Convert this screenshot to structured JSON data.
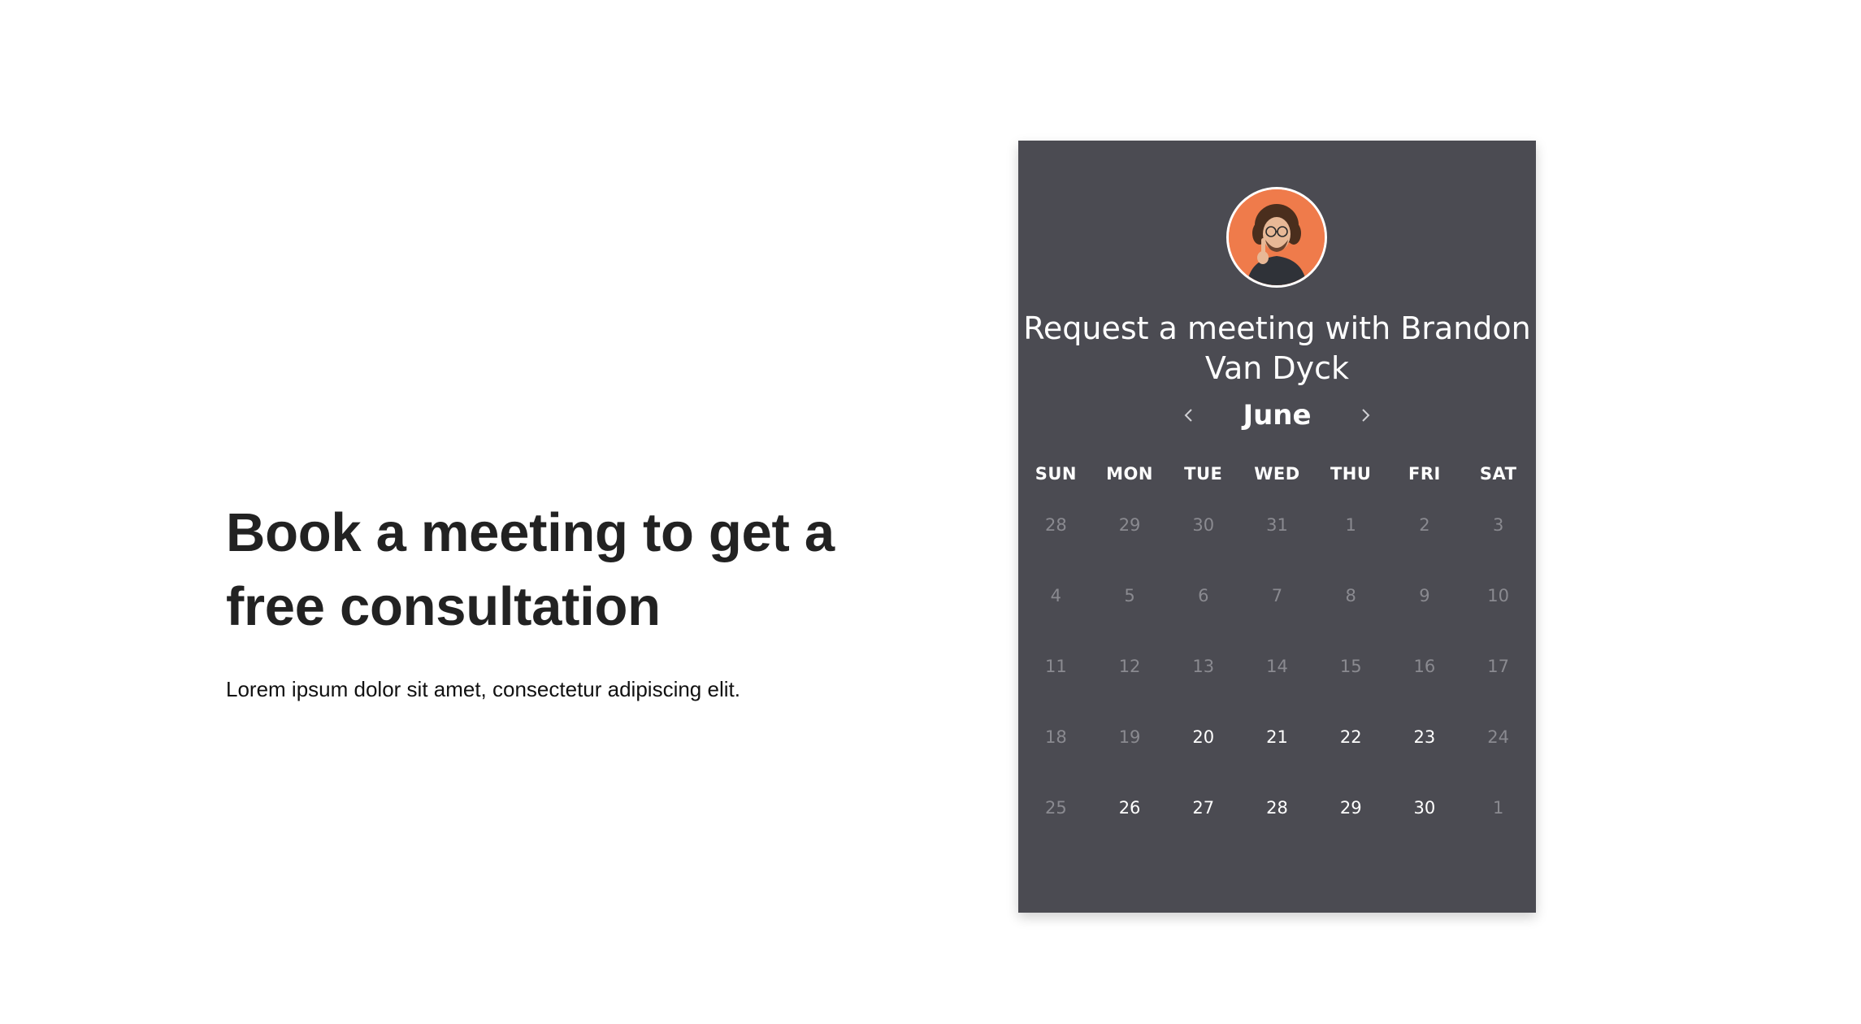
{
  "hero": {
    "headline": "Book a meeting to get a free consultation",
    "subtext": "Lorem ipsum dolor sit amet, consectetur adipiscing elit."
  },
  "scheduler": {
    "avatar_icon": "person-photo",
    "title": "Request a meeting with Brandon Van Dyck",
    "month": "June",
    "prev_icon": "chevron-left-icon",
    "next_icon": "chevron-right-icon",
    "weekdays": [
      "SUN",
      "MON",
      "TUE",
      "WED",
      "THU",
      "FRI",
      "SAT"
    ],
    "days": [
      {
        "label": "28",
        "available": false
      },
      {
        "label": "29",
        "available": false
      },
      {
        "label": "30",
        "available": false
      },
      {
        "label": "31",
        "available": false
      },
      {
        "label": "1",
        "available": false
      },
      {
        "label": "2",
        "available": false
      },
      {
        "label": "3",
        "available": false
      },
      {
        "label": "4",
        "available": false
      },
      {
        "label": "5",
        "available": false
      },
      {
        "label": "6",
        "available": false
      },
      {
        "label": "7",
        "available": false
      },
      {
        "label": "8",
        "available": false
      },
      {
        "label": "9",
        "available": false
      },
      {
        "label": "10",
        "available": false
      },
      {
        "label": "11",
        "available": false
      },
      {
        "label": "12",
        "available": false
      },
      {
        "label": "13",
        "available": false
      },
      {
        "label": "14",
        "available": false
      },
      {
        "label": "15",
        "available": false
      },
      {
        "label": "16",
        "available": false
      },
      {
        "label": "17",
        "available": false
      },
      {
        "label": "18",
        "available": false
      },
      {
        "label": "19",
        "available": false
      },
      {
        "label": "20",
        "available": true
      },
      {
        "label": "21",
        "available": true
      },
      {
        "label": "22",
        "available": true
      },
      {
        "label": "23",
        "available": true
      },
      {
        "label": "24",
        "available": false
      },
      {
        "label": "25",
        "available": false
      },
      {
        "label": "26",
        "available": true
      },
      {
        "label": "27",
        "available": true
      },
      {
        "label": "28",
        "available": true
      },
      {
        "label": "29",
        "available": true
      },
      {
        "label": "30",
        "available": true
      },
      {
        "label": "1",
        "available": false
      }
    ],
    "colors": {
      "card_background": "#4b4b52",
      "available_day": "#ffffff",
      "unavailable_day": "#8a8a90",
      "avatar_background": "#ef7b4b"
    }
  }
}
